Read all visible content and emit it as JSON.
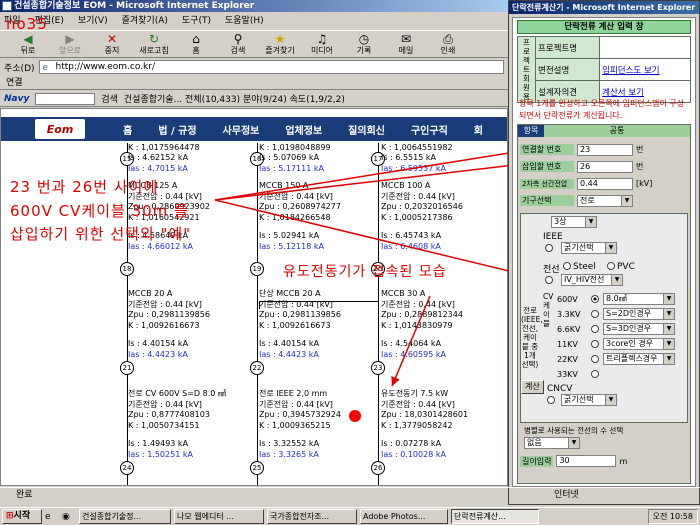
{
  "browser": {
    "title": "건설종합기술정보 EOM - Microsoft Internet Explorer",
    "menu": [
      "파일",
      "편집(E)",
      "보기(V)",
      "즐겨찾기(A)",
      "도구(T)",
      "도움말(H)"
    ],
    "toolbar": [
      "뒤로",
      "앞으로",
      "중지",
      "새로고침",
      "홈",
      "검색",
      "즐겨찾기",
      "미디어",
      "기록",
      "메일",
      "인쇄"
    ],
    "address_label": "주소(D)",
    "address": "http://www.eom.co.kr/",
    "links_label": "연결",
    "navy": {
      "brand": "Navy",
      "search_label": "검색",
      "ticker": "건설종합기술...   전체(10,433)  분야(9/24)  속도(1,9/2,2)"
    },
    "status": "완료",
    "status_zone": "인터넷"
  },
  "site": {
    "logo": "Eom",
    "nav": [
      "홈",
      "법 / 규정",
      "사무정보",
      "업체정보",
      "질의회신",
      "구인구직",
      "회"
    ]
  },
  "diagram": {
    "rows": [
      {
        "node": "15",
        "is": "Is : 4.62152 kA",
        "ias": "Ias : 4.7015 kA",
        "k0": "K : 1,0175964478"
      },
      {
        "node": "16",
        "is": "Is : 5.07069 kA",
        "ias": "Ias : 5.17111 kA",
        "k0": "K : 1,0198048899"
      },
      {
        "node": "17",
        "is": "Is : 6.5515 kA",
        "ias": "Ias : 6.59537 kA",
        "k0": "K : 1,0064551982"
      }
    ],
    "col1": [
      "MCCB 125 A",
      "기준전압 : 0.44 [kV]",
      "Zpu : 0,2860923902",
      "K : 1,0160542921",
      "Is : 4.58649 kA",
      "Ias : 4.66012 kA",
      "MCCB 20 A",
      "기준전압 : 0.44 [kV]",
      "Zpu : 0,2981139856",
      "K : 1,0092616673",
      "Is : 4.40154 kA",
      "Ias : 4.4423 kA",
      "전로 CV 600V S=D 8.0 ㎟",
      "기준전압 : 0.44 [kV]",
      "Zpu : 0,8777408103",
      "K : 1,0050734151",
      "Is : 1.49493 kA",
      "Ias : 1.50251 kA"
    ],
    "col2": [
      "MCCB 150 A",
      "기준전압 : 0.44 [kV]",
      "Zpu : 0,2608974277",
      "K : 1,0184266548",
      "Is : 5.02941 kA",
      "Ias : 5.12118 kA",
      "단상 MCCB 20 A",
      "기준전압 : 0.44 [kV]",
      "Zpu : 0,2981139856",
      "K : 1,0092616673",
      "Is : 4.40154 kA",
      "Ias : 4.4423 kA",
      "전로 IEEE 2,0 mm",
      "기준전압 : 0.44 [kV]",
      "Zpu : 0,3945732924",
      "K : 1,0009365215",
      "Is : 3.32552 kA",
      "Ias : 3.3265 kA"
    ],
    "col3": [
      "MCCB 100 A",
      "기준전압 : 0.44 [kV]",
      "Zpu : 0,2032016546",
      "K : 1,0005217386",
      "Is : 6.45743 kA",
      "Ias : 6.4608 kA",
      "MCCB 30 A",
      "기준전압 : 0.44 [kV]",
      "Zpu : 0,2889812344",
      "K : 1,0143830979",
      "Is : 4.54064 kA",
      "Ias : 4.60595 kA",
      "유도전동기 7.5 kW",
      "기준전압 : 0.44 [kV]",
      "Zpu : 18,0301428601",
      "K : 1,3779058242",
      "Is : 0.07278 kA",
      "Ias : 0.10028 kA"
    ],
    "nodes_mid": [
      "18",
      "19",
      "20"
    ],
    "nodes_low": [
      "21",
      "22",
      "23"
    ],
    "nodes_bot": [
      "24",
      "25",
      "26"
    ]
  },
  "annotations": {
    "tag": "no35",
    "text1": "23 번과 26번 사이에",
    "text2": "600V CV케이블 30m 를",
    "text3": "삽입하기 위한 선택의 \"예\"",
    "text4": "유도전동기가 접속된 모습"
  },
  "popup": {
    "title": "단락전류계산기 - Microsoft Internet Explorer",
    "heading": "단락전류 계산 입력 창",
    "proj_label": "프로젝트명",
    "rows": [
      {
        "label": "프로젝트명",
        "value": ""
      },
      {
        "label": "변전설명",
        "value": "임피던스도 보기"
      },
      {
        "label": "설계자의견",
        "value": "계산서 보기"
      }
    ],
    "side_label": "프로젝트회원용",
    "note": "항목 1개를 완성하고 오른쪽에 임피던스맵이 구성되면서 단락전류가 계산됩니다.",
    "tab_item": "항목",
    "tab_common": "공통",
    "f_conn_label": "연결할 번호",
    "f_conn_val": "23",
    "f_conn_unit": "번",
    "f_ins_label": "삽입할 번호",
    "f_ins_val": "26",
    "f_ins_unit": "번",
    "f_v2_label": "2차측 선간전압",
    "f_v2_val": "0.44",
    "f_v2_unit": "[kV]",
    "f_type_label": "기구선택",
    "f_type_val": "전로",
    "phase": "3상",
    "ieee_label": "IEEE",
    "ieee_sel": "굵기선택",
    "wire_label": "전선",
    "steel": "Steel",
    "pvc": "PVC",
    "wire_sel": "IV_HIV전선",
    "cv_label": "CV 케이블",
    "left_group": "전로 (IEEE, 전선, 케이블 중 1개 선택)",
    "cv_rows": [
      {
        "v": "600V",
        "s": "8.0㎟"
      },
      {
        "v": "3.3KV",
        "s": "S=2D인경우"
      },
      {
        "v": "6.6KV",
        "s": "S=3D인경우"
      },
      {
        "v": "11KV",
        "s": "3core인 경우"
      },
      {
        "v": "22KV",
        "s": "트리플렉스경우"
      },
      {
        "v": "33KV",
        "s": ""
      }
    ],
    "calc_btn": "계산",
    "cncv_label": "CNCV",
    "cncv_sel": "굵기선택",
    "parallel_label": "병렬로 사용되는 전선의 수 선택",
    "parallel_val": "없음",
    "len_label": "길이입력",
    "len_val": "30",
    "len_unit": "m"
  },
  "taskbar": {
    "start": "시작",
    "tasks": [
      "건설종합기술정...",
      "나모 웹에디터 ...",
      "국가종합전자조...",
      "Adobe Photos...",
      "단락전류계산..."
    ],
    "clock": "오전 10:58"
  }
}
